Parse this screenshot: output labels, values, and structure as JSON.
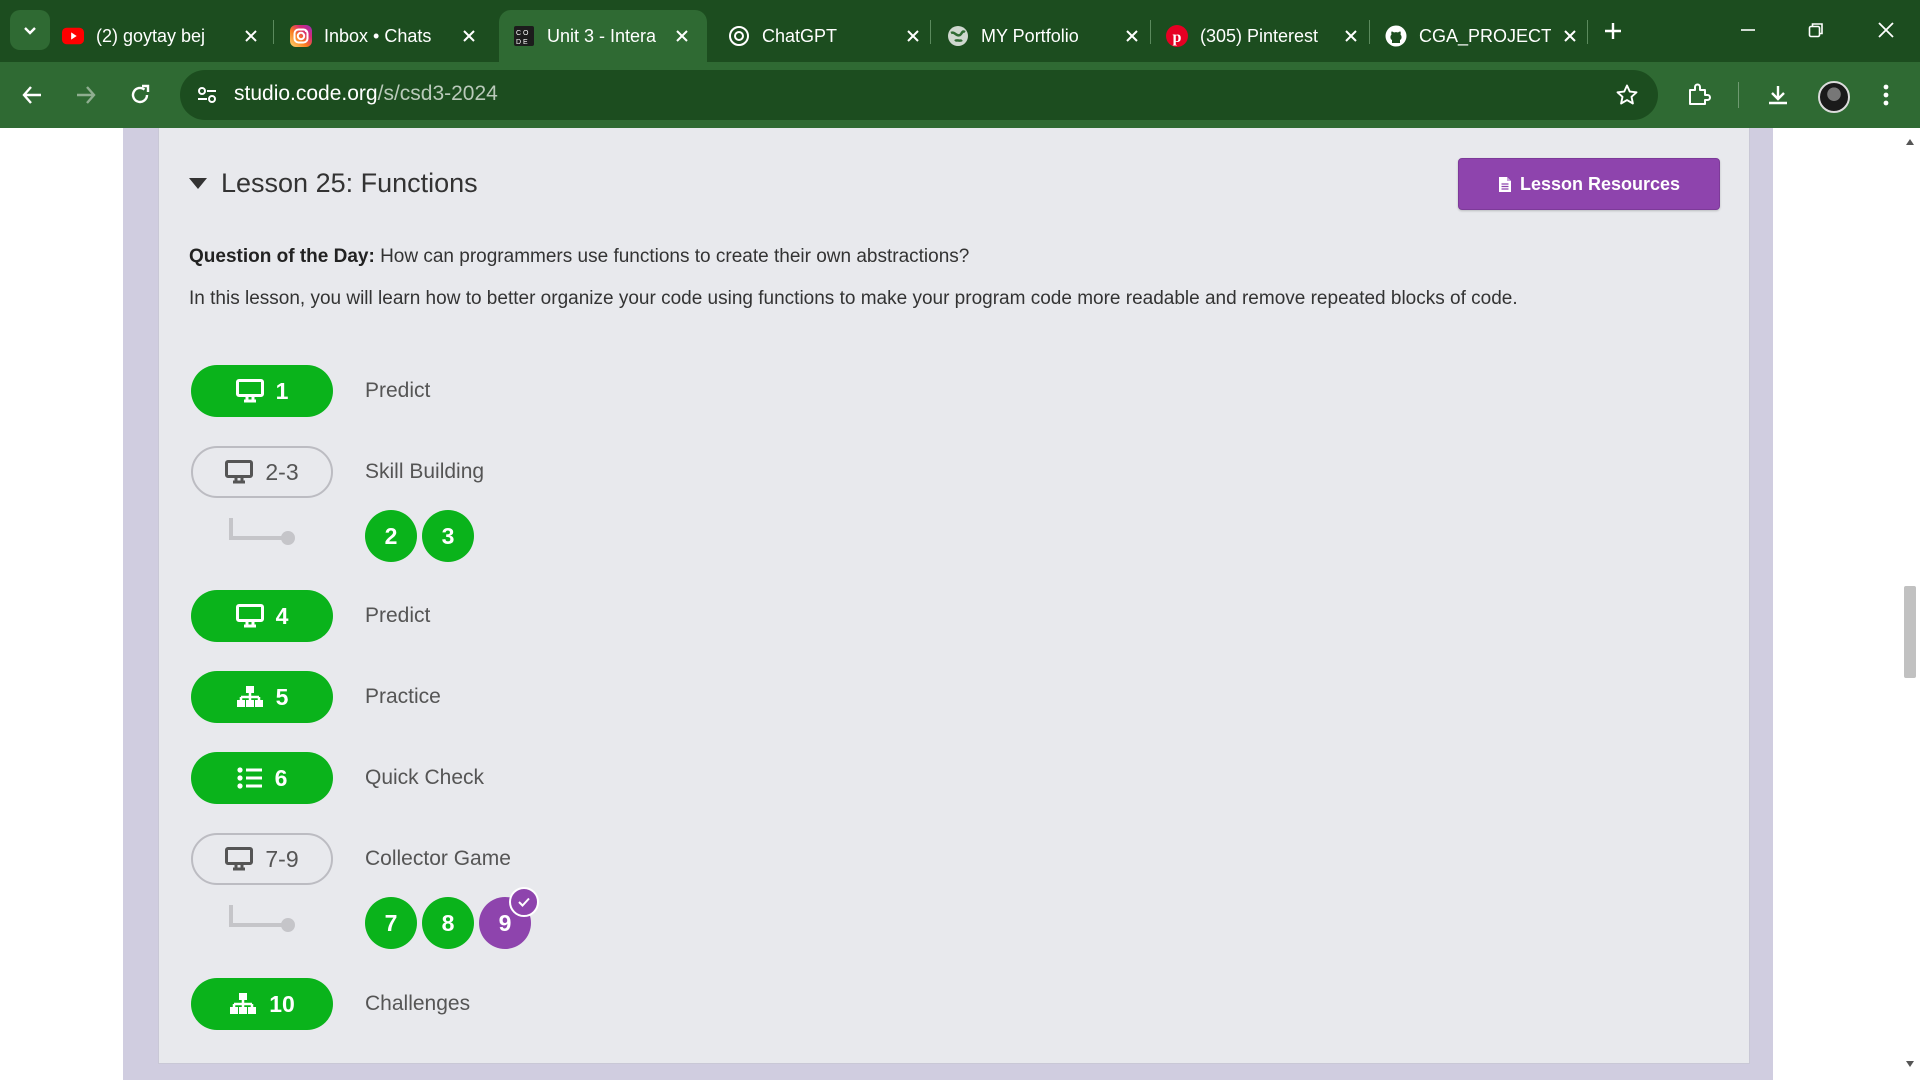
{
  "browser": {
    "tabs": [
      {
        "title": "(2) goytay bej",
        "icon": "youtube-icon",
        "active": false
      },
      {
        "title": "Inbox • Chats",
        "icon": "instagram-icon",
        "active": false
      },
      {
        "title": "Unit 3 - Intera",
        "icon": "code-org-icon",
        "active": true
      },
      {
        "title": "ChatGPT",
        "icon": "chatgpt-icon",
        "active": false
      },
      {
        "title": "MY Portfolio",
        "icon": "globe-icon",
        "active": false
      },
      {
        "title": "(305) Pinterest",
        "icon": "pinterest-icon",
        "active": false
      },
      {
        "title": "CGA_PROJECT",
        "icon": "github-icon",
        "active": false
      }
    ],
    "url": {
      "domain": "studio.code.org",
      "path": "/s/csd3-2024"
    },
    "colors": {
      "frame": "#1c4d1f",
      "toolbar": "#2f6a33"
    }
  },
  "lesson": {
    "title": "Lesson 25: Functions",
    "resources_label": "Lesson Resources",
    "qotd_label": "Question of the Day:",
    "qotd_text": " How can programmers use functions to create their own abstractions?",
    "description": "In this lesson, you will learn how to better organize your code using functions to make your program code more readable and remove repeated blocks of code.",
    "levels": [
      {
        "pill": "1",
        "label": "Predict",
        "icon": "monitor-icon",
        "style": "green"
      },
      {
        "pill": "2-3",
        "label": "Skill Building",
        "icon": "monitor-icon",
        "style": "outline",
        "sublevels": [
          "2",
          "3"
        ]
      },
      {
        "pill": "4",
        "label": "Predict",
        "icon": "monitor-icon",
        "style": "green"
      },
      {
        "pill": "5",
        "label": "Practice",
        "icon": "sitemap-icon",
        "style": "green"
      },
      {
        "pill": "6",
        "label": "Quick Check",
        "icon": "list-icon",
        "style": "green"
      },
      {
        "pill": "7-9",
        "label": "Collector Game",
        "icon": "monitor-icon",
        "style": "outline",
        "sublevels": [
          "7",
          "8",
          "9"
        ]
      },
      {
        "pill": "10",
        "label": "Challenges",
        "icon": "sitemap-icon",
        "style": "green"
      }
    ],
    "colors": {
      "complete": "#0ab31b",
      "current": "#8e44ad"
    }
  }
}
